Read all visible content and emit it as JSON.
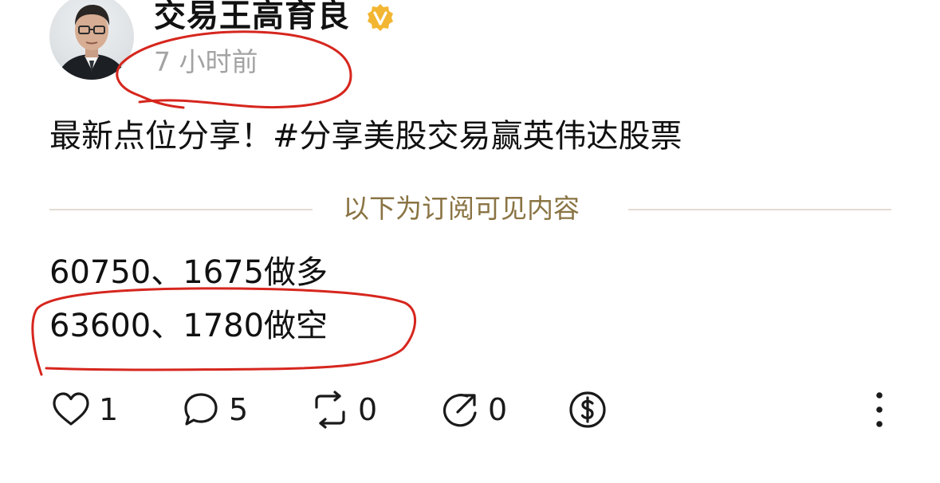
{
  "post": {
    "author": "交易王高育良",
    "time": "7 小时前",
    "text": "最新点位分享！#分享美股交易赢英伟达股票",
    "divider": "以下为订阅可见内容",
    "lines": [
      "60750、1675做多",
      "63600、1780做空"
    ]
  },
  "actions": {
    "like_count": "1",
    "comment_count": "5",
    "repost_count": "0",
    "share_count": "0"
  },
  "colors": {
    "timestamp": "#a3a3a3",
    "divider_text": "#8a7444",
    "verified_badge": "#f2b632",
    "annotation": "#d6261e"
  },
  "icons": [
    "avatar-photo",
    "verified-badge-icon",
    "heart-icon",
    "comment-icon",
    "repost-icon",
    "share-icon",
    "dollar-tip-icon",
    "more-vertical-icon"
  ]
}
